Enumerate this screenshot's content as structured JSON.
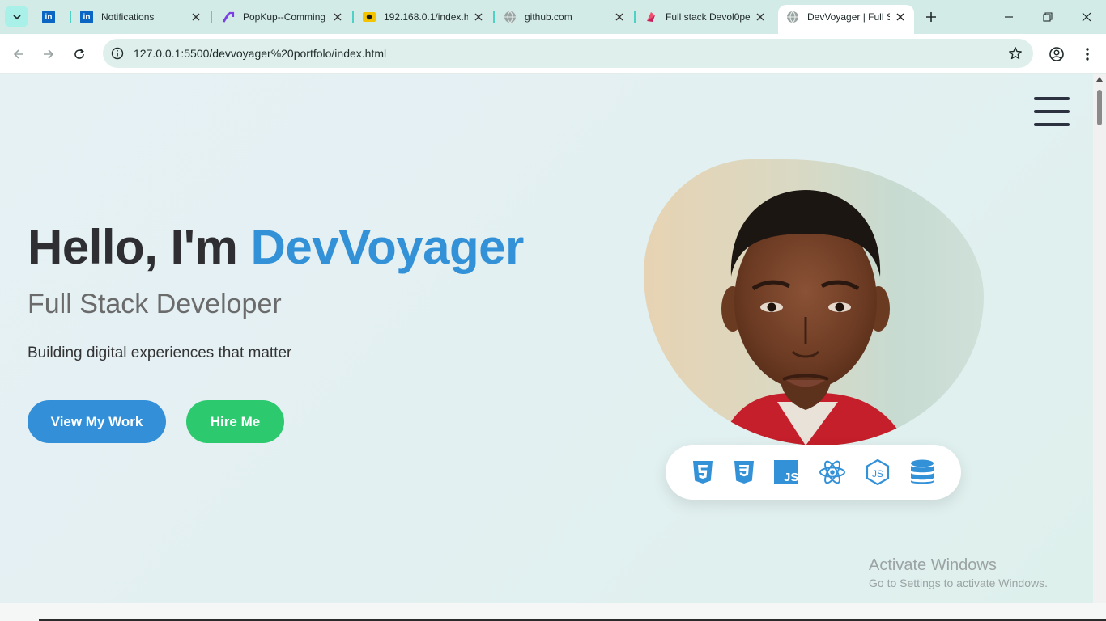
{
  "tabs": [
    {
      "title": "",
      "icon": "linkedin-icon"
    },
    {
      "title": "Notifications",
      "icon": "linkedin-icon"
    },
    {
      "title": "PopKup--Comming",
      "icon": "popkup-icon"
    },
    {
      "title": "192.168.0.1/index.h",
      "icon": "router-icon"
    },
    {
      "title": "github.com",
      "icon": "globe-icon"
    },
    {
      "title": "Full stack Devol0pe",
      "icon": "figma-icon"
    },
    {
      "title": "DevVoyager | Full St",
      "icon": "globe-icon",
      "active": true
    }
  ],
  "address_bar": {
    "url": "127.0.0.1:5500/devvoyager%20portfolo/index.html"
  },
  "hero": {
    "greeting": "Hello, I'm ",
    "name": "DevVoyager",
    "role": "Full Stack Developer",
    "tagline": "Building digital experiences that matter",
    "primary_button": "View My Work",
    "secondary_button": "Hire Me"
  },
  "tech_icons": [
    "html5-icon",
    "css3-icon",
    "javascript-icon",
    "react-icon",
    "nodejs-icon",
    "database-icon"
  ],
  "watermark": {
    "title": "Activate Windows",
    "subtitle": "Go to Settings to activate Windows."
  },
  "colors": {
    "accent": "#3391d8",
    "hire": "#2dc96f",
    "heading": "#2f2f33",
    "tabstrip": "#d3ebe6"
  }
}
